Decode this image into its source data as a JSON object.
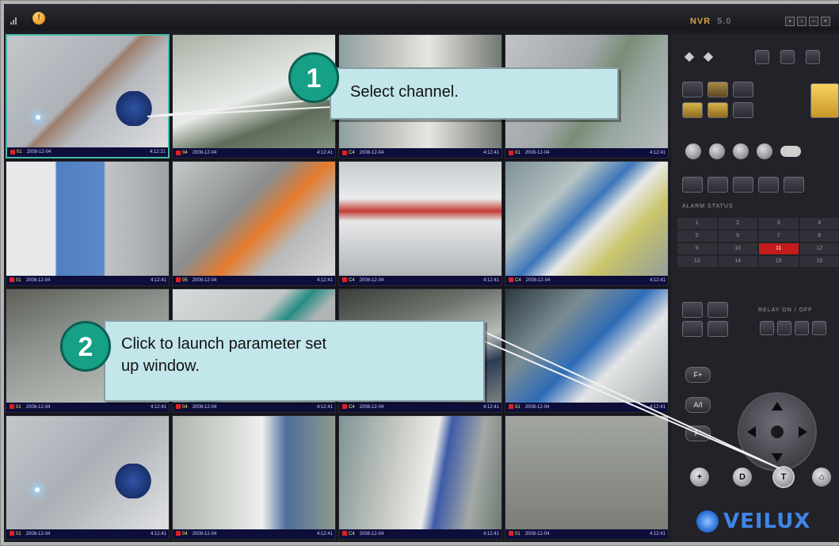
{
  "titlebar": {
    "app_name": "NVR",
    "version": "5.0",
    "window_buttons": [
      "▪",
      "▫",
      "–",
      "×"
    ]
  },
  "channels": [
    {
      "ch": "01",
      "date": "2008-12-04",
      "time": "4:12:21"
    },
    {
      "ch": "04",
      "date": "2008-12-04",
      "time": "4:12:41"
    },
    {
      "ch": "C4",
      "date": "2008-12-04",
      "time": "4:12:41"
    },
    {
      "ch": "01",
      "date": "2008-12-04",
      "time": "4:12:41"
    },
    {
      "ch": "01",
      "date": "2008-12-04",
      "time": "4:12:41"
    },
    {
      "ch": "05",
      "date": "2008-12-04",
      "time": "4:12:41"
    },
    {
      "ch": "C4",
      "date": "2008-12-04",
      "time": "4:12:41"
    },
    {
      "ch": "C4",
      "date": "2008-12-04",
      "time": "4:12:41"
    },
    {
      "ch": "01",
      "date": "2008-12-04",
      "time": "4:12:41"
    },
    {
      "ch": "04",
      "date": "2008-12-04",
      "time": "4:12:41"
    },
    {
      "ch": "C4",
      "date": "2008-12-04",
      "time": "4:12:41"
    },
    {
      "ch": "01",
      "date": "2008-12-04",
      "time": "4:12:41"
    },
    {
      "ch": "01",
      "date": "2008-12-04",
      "time": "4:12:41"
    },
    {
      "ch": "04",
      "date": "2008-12-04",
      "time": "4:12:41"
    },
    {
      "ch": "C4",
      "date": "2008-12-04",
      "time": "4:12:41"
    },
    {
      "ch": "01",
      "date": "2008-12-04",
      "time": "4:12:41"
    }
  ],
  "panel": {
    "alarm_label": "ALARM STATUS",
    "alarm_cells": [
      "1",
      "2",
      "3",
      "4",
      "5",
      "6",
      "7",
      "8",
      "9",
      "10",
      "11",
      "12",
      "13",
      "14",
      "15",
      "16"
    ],
    "alarm_active": "11",
    "relay_label": "RELAY ON / OFF",
    "f_plus": "F+",
    "a_plus": "A/I",
    "f_minus": "F-",
    "brand": "VEILUX"
  },
  "callouts": [
    {
      "number": "1",
      "text": "Select channel."
    },
    {
      "number": "2",
      "text": "Click to launch parameter set up window."
    }
  ]
}
